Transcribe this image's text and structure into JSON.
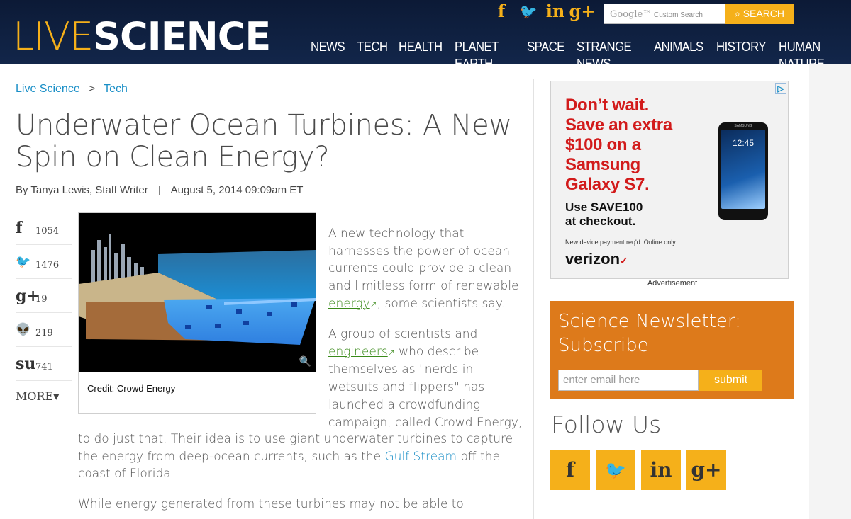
{
  "header": {
    "logo_live": "LIVE",
    "logo_science": "SCIENCE",
    "social_icons": [
      {
        "name": "facebook-icon",
        "glyph": "f"
      },
      {
        "name": "twitter-icon",
        "glyph": "🐦"
      },
      {
        "name": "linkedin-icon",
        "glyph": "in"
      },
      {
        "name": "googleplus-icon",
        "glyph": "g+"
      }
    ],
    "search_placeholder_brand": "Google™",
    "search_placeholder": "Custom Search",
    "search_button": "SEARCH",
    "nav": [
      "NEWS",
      "TECH",
      "HEALTH",
      "PLANET EARTH",
      "SPACE",
      "STRANGE NEWS",
      "ANIMALS",
      "HISTORY",
      "HUMAN NATURE"
    ]
  },
  "breadcrumb": {
    "root": "Live Science",
    "sep": ">",
    "current": "Tech"
  },
  "article": {
    "title": "Underwater Ocean Turbines: A New Spin on Clean Energy?",
    "author": "By Tanya Lewis, Staff Writer",
    "date": "August 5, 2014 09:09am ET",
    "figure_caption": "Credit: Crowd Energy",
    "p1_a": "A new technology that harnesses the power of ocean currents could provide a clean and limitless form of renewable ",
    "p1_link": "energy",
    "p1_b": ", some scientists say.",
    "p2_a": "A group of scientists and ",
    "p2_link": "engineers",
    "p2_b": " who describe themselves as \"nerds in wetsuits and flippers\" has launched a crowdfunding campaign, called Crowd Energy,",
    "p2c_a": "to do just that. Their idea is to use giant underwater turbines to capture the energy from deep-ocean currents, such as the ",
    "p2c_link": "Gulf Stream",
    "p2c_b": " off the coast of Florida.",
    "p3": "While energy generated from these turbines may not be able to"
  },
  "share": {
    "items": [
      {
        "icon": "facebook-icon",
        "glyph": "f",
        "count": "1054"
      },
      {
        "icon": "twitter-icon",
        "glyph": "🐦",
        "count": "1476"
      },
      {
        "icon": "googleplus-icon",
        "glyph": "g+",
        "count": "19"
      },
      {
        "icon": "reddit-icon",
        "glyph": "👽",
        "count": "219"
      },
      {
        "icon": "stumbleupon-icon",
        "glyph": "su",
        "count": "741"
      }
    ],
    "more": "MORE"
  },
  "ad": {
    "headline_lines": [
      "Don’t wait.",
      "Save an extra",
      "$100 on a",
      "Samsung",
      "Galaxy S7."
    ],
    "code_lines": [
      "Use SAVE100",
      "at checkout."
    ],
    "fine_print": "New device payment req'd. Online only.",
    "brand": "verizon",
    "phone_time": "12:45",
    "phone_brand": "SAMSUNG",
    "label": "Advertisement"
  },
  "newsletter": {
    "title_line1": "Science Newsletter:",
    "title_line2": "Subscribe",
    "placeholder": "enter email here",
    "button": "submit"
  },
  "follow": {
    "title": "Follow Us",
    "icons": [
      {
        "name": "facebook-icon",
        "glyph": "f"
      },
      {
        "name": "twitter-icon",
        "glyph": "🐦"
      },
      {
        "name": "linkedin-icon",
        "glyph": "in"
      },
      {
        "name": "googleplus-icon",
        "glyph": "g+"
      }
    ]
  },
  "colors": {
    "accent": "#f5b01a",
    "header_bg": "#0f1f3d",
    "link": "#1a8fc7",
    "newsletter_bg": "#dd7a1b",
    "ad_red": "#d21b1b"
  }
}
